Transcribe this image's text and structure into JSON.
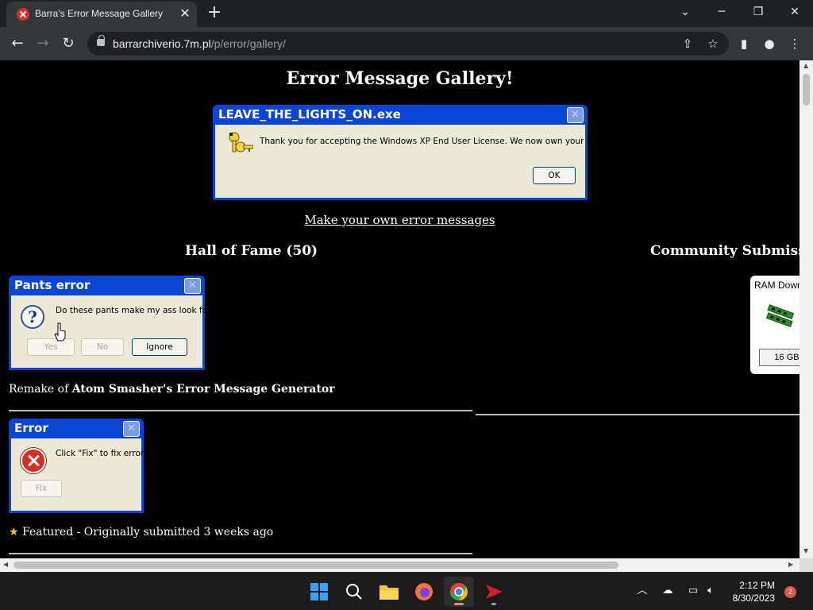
{
  "browser": {
    "tab_title": "Barra's Error Message Gallery",
    "url_host": "barrarchiverio.7m.pl",
    "url_path": "/p/error/gallery/"
  },
  "page": {
    "title": "Error Message Gallery!",
    "make_link": "Make your own error messages",
    "hall_heading": "Hall of Fame (50)",
    "community_heading": "Community Submissions"
  },
  "main_dialog": {
    "title": "LEAVE_THE_LIGHTS_ON.exe",
    "message": "Thank you for accepting the Windows XP End User License. We now own your house!",
    "ok": "OK",
    "icon": "keys-icon"
  },
  "pants_dialog": {
    "title": "Pants error",
    "message": "Do these pants make my ass look fat?",
    "yes": "Yes",
    "no": "No",
    "ignore": "Ignore",
    "icon": "question-icon"
  },
  "pants_caption": {
    "prefix": "Remake of",
    "bold": "Atom Smasher's Error Message Generator"
  },
  "error_dialog": {
    "title": "Error",
    "message": "Click \"Fix\" to fix error.",
    "fix": "Fix",
    "icon": "error-icon"
  },
  "error_caption": "Featured - Originally submitted 3 weeks ago",
  "ram_card": {
    "title": "RAM Download",
    "button": "16 GB"
  },
  "taskbar": {
    "time": "2:12 PM",
    "date": "8/30/2023",
    "notifications": "2"
  }
}
